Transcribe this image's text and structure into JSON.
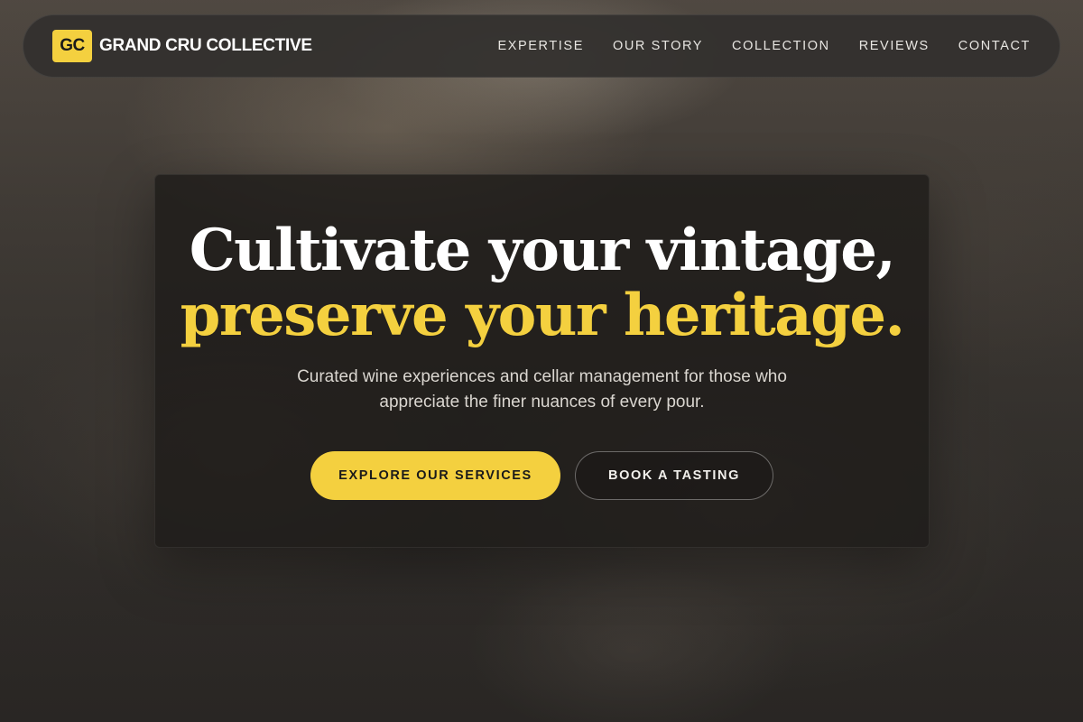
{
  "brand": {
    "badge": "GC",
    "name": "GRAND CRU COLLECTIVE"
  },
  "nav": {
    "items": [
      {
        "label": "EXPERTISE"
      },
      {
        "label": "OUR STORY"
      },
      {
        "label": "COLLECTION"
      },
      {
        "label": "REVIEWS"
      },
      {
        "label": "CONTACT"
      }
    ]
  },
  "hero": {
    "headline_line1": "Cultivate your vintage,",
    "headline_line2": "preserve your heritage.",
    "subtitle": "Curated wine experiences and cellar management for those who appreciate the finer nuances of every pour.",
    "primary_button": "EXPLORE OUR SERVICES",
    "secondary_button": "BOOK A TASTING"
  },
  "colors": {
    "accent": "#f4d03f",
    "nav_background": "#32302e",
    "card_background": "#1e1c1a"
  }
}
